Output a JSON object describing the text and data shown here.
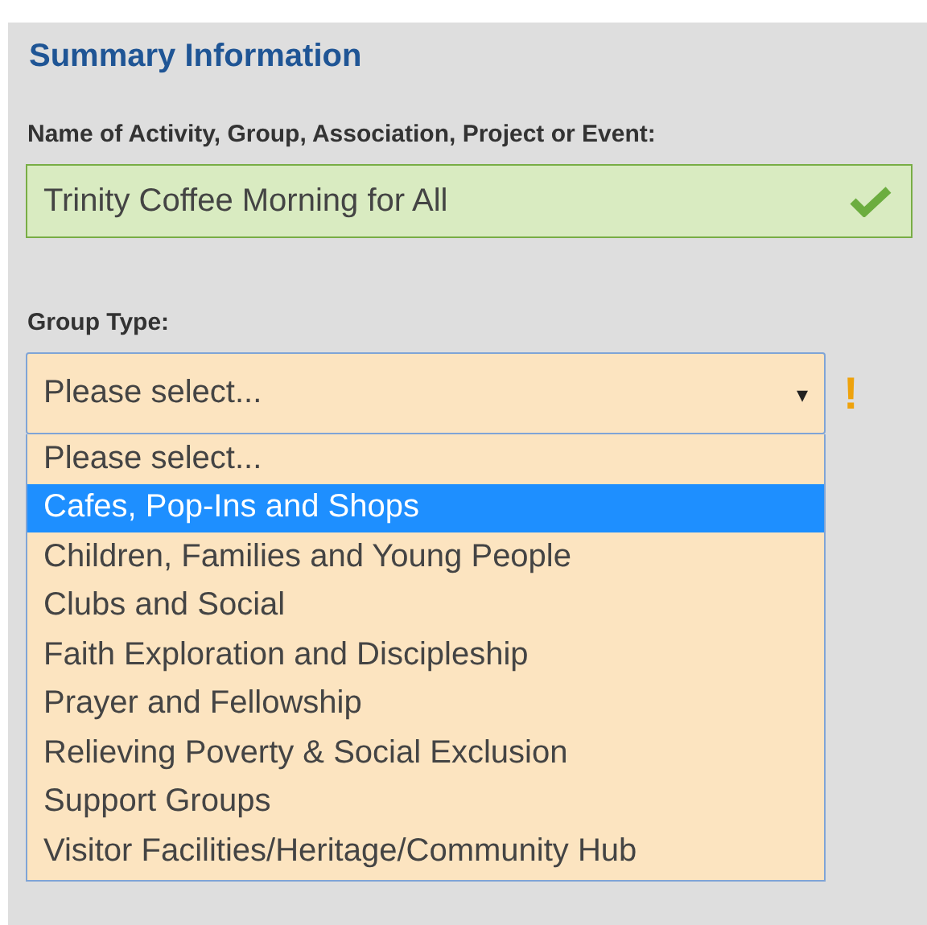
{
  "section": {
    "title": "Summary Information"
  },
  "name_field": {
    "label": "Name of Activity, Group, Association, Project or Event:",
    "value": "Trinity Coffee Morning for All",
    "valid": true
  },
  "group_type": {
    "label": "Group Type:",
    "value": "Please select...",
    "warning": true,
    "expanded": true,
    "warning_mark": "!",
    "caret": "▾",
    "options": [
      {
        "label": "Please select...",
        "highlighted": false
      },
      {
        "label": "Cafes, Pop-Ins and Shops",
        "highlighted": true
      },
      {
        "label": "Children, Families and Young People",
        "highlighted": false
      },
      {
        "label": "Clubs and Social",
        "highlighted": false
      },
      {
        "label": "Faith Exploration and Discipleship",
        "highlighted": false
      },
      {
        "label": "Prayer and Fellowship",
        "highlighted": false
      },
      {
        "label": "Relieving Poverty & Social Exclusion",
        "highlighted": false
      },
      {
        "label": "Support Groups",
        "highlighted": false
      },
      {
        "label": "Visitor Facilities/Heritage/Community Hub",
        "highlighted": false
      }
    ]
  }
}
